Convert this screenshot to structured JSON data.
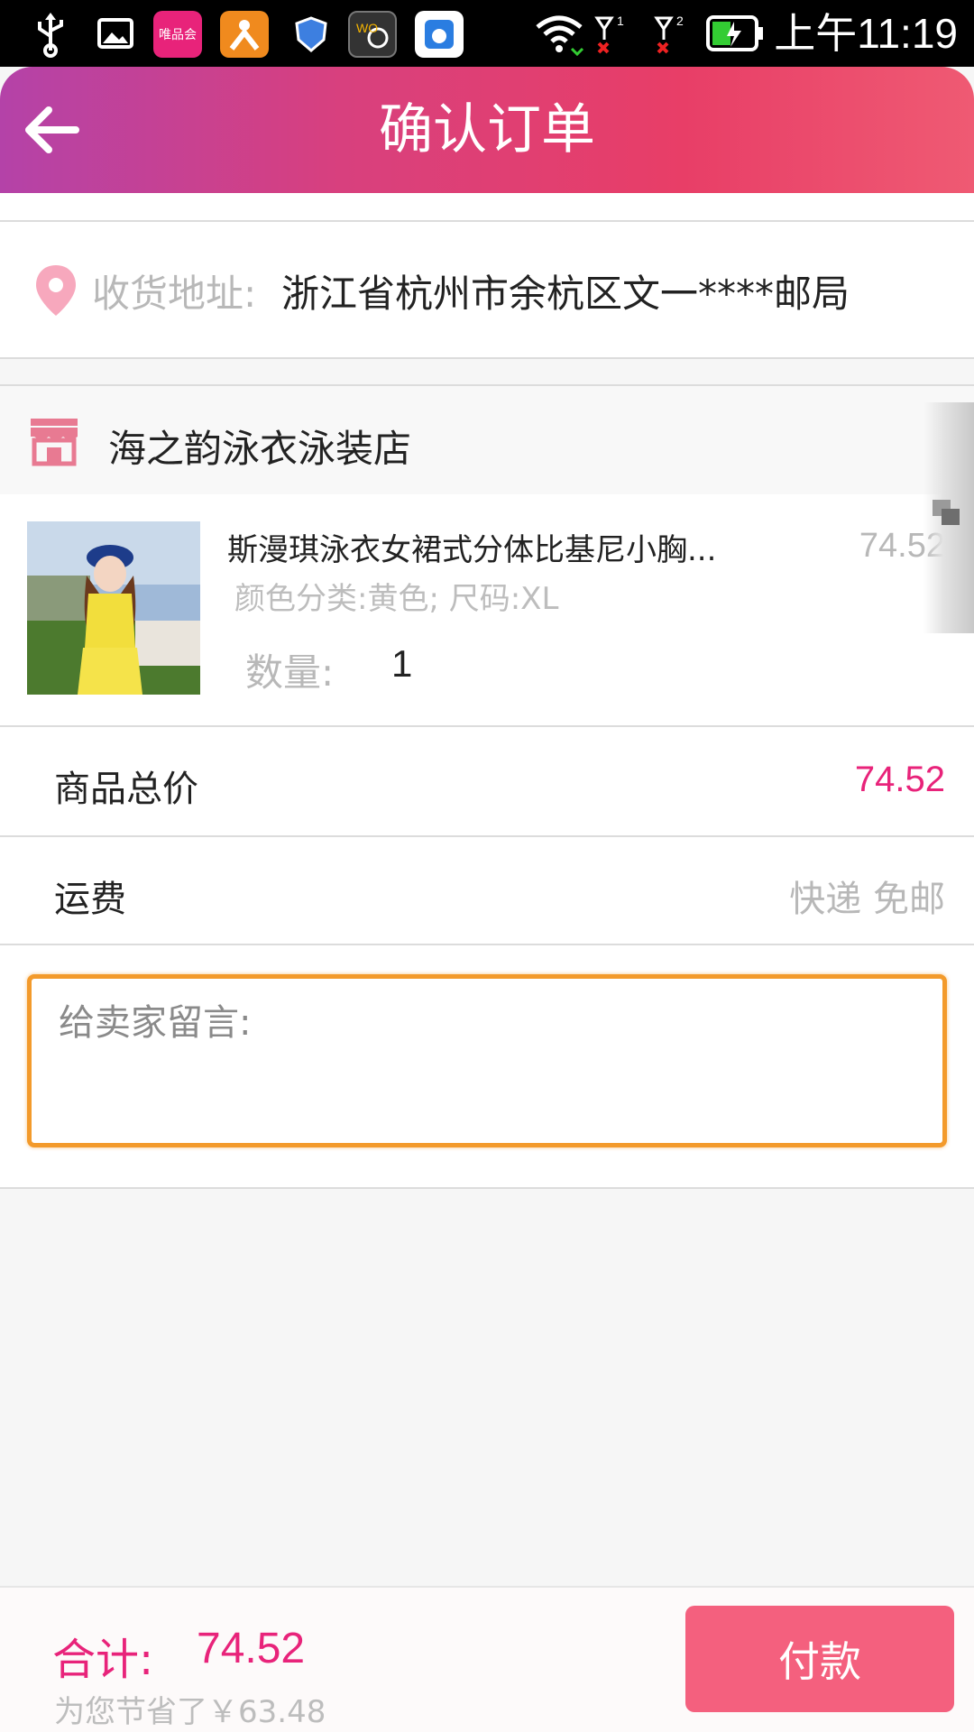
{
  "status_bar": {
    "time": "上午11:19",
    "notif_icons": [
      "usb-icon",
      "image-icon",
      "vip-app-icon",
      "dianping-app-icon",
      "shield-app-icon",
      "wo-store-app-icon",
      "baidu-app-icon"
    ],
    "vip_label": "唯品会"
  },
  "header": {
    "title": "确认订单"
  },
  "address": {
    "label": "收货地址:",
    "value": "浙江省杭州市余杭区文一****邮局"
  },
  "store": {
    "name": "海之韵泳衣泳装店"
  },
  "product": {
    "title": "斯漫琪泳衣女裙式分体比基尼小胸...",
    "price": "74.52",
    "spec": "颜色分类:黄色; 尺码:XL",
    "qty_label": "数量:",
    "qty_value": "1"
  },
  "summary": {
    "subtotal_label": "商品总价",
    "subtotal_value": "74.52",
    "shipping_label": "运费",
    "shipping_value": "快递 免邮"
  },
  "message": {
    "placeholder": "给卖家留言:"
  },
  "footer": {
    "total_label": "合计:",
    "total_value": "74.52",
    "saved_text": "为您节省了￥63.48",
    "pay_label": "付款"
  },
  "colors": {
    "accent": "#e8237a",
    "pay_button": "#f4607e",
    "message_border": "#f39a2b"
  }
}
